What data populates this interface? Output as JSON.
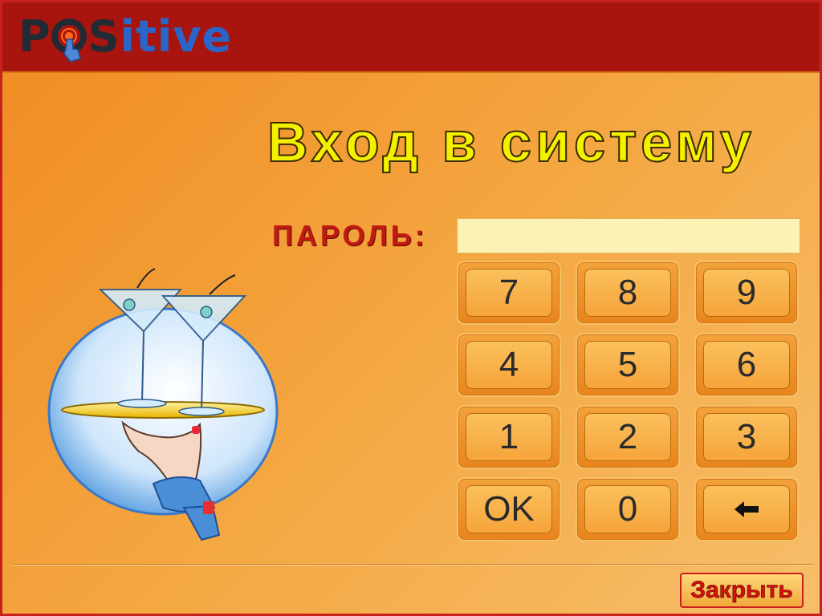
{
  "logo": {
    "part1": "P",
    "part2": "S",
    "part3": "itive"
  },
  "title": "Вход в систему",
  "password": {
    "label": "ПАРОЛЬ:",
    "value": "",
    "placeholder": ""
  },
  "keypad": {
    "k7": "7",
    "k8": "8",
    "k9": "9",
    "k4": "4",
    "k5": "5",
    "k6": "6",
    "k1": "1",
    "k2": "2",
    "k3": "3",
    "ok": "OK",
    "k0": "0",
    "backspace": "🡐"
  },
  "close_label": "Закрыть",
  "colors": {
    "header": "#a8140e",
    "title_fill": "#f4f000",
    "password_label": "#c01a12",
    "input_bg": "#fdf2b6",
    "key_face": "#f5a43a",
    "close_text": "#d4120c"
  },
  "icons": {
    "logo_cursor": "hand-pointer-icon",
    "backspace": "arrow-left-icon",
    "illustration": "waiter-hand-cocktails-icon"
  }
}
